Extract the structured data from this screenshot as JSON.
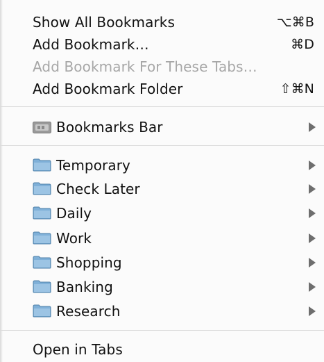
{
  "menu": {
    "top_items": [
      {
        "label": "Show All Bookmarks",
        "shortcut": "⌥⌘B",
        "enabled": true
      },
      {
        "label": "Add Bookmark…",
        "shortcut": "⌘D",
        "enabled": true
      },
      {
        "label": "Add Bookmark For These Tabs…",
        "shortcut": "",
        "enabled": false
      },
      {
        "label": "Add Bookmark Folder",
        "shortcut": "⇧⌘N",
        "enabled": true
      }
    ],
    "bookmarks_bar": {
      "label": "Bookmarks Bar",
      "icon": "bookmarks-bar-icon",
      "has_submenu": true
    },
    "folders": [
      {
        "label": "Temporary",
        "icon": "folder-icon",
        "has_submenu": true
      },
      {
        "label": "Check Later",
        "icon": "folder-icon",
        "has_submenu": true
      },
      {
        "label": "Daily",
        "icon": "folder-icon",
        "has_submenu": true
      },
      {
        "label": "Work",
        "icon": "folder-icon",
        "has_submenu": true
      },
      {
        "label": "Shopping",
        "icon": "folder-icon",
        "has_submenu": true
      },
      {
        "label": "Banking",
        "icon": "folder-icon",
        "has_submenu": true
      },
      {
        "label": "Research",
        "icon": "folder-icon",
        "has_submenu": true
      }
    ],
    "bottom_item": {
      "label": "Open in Tabs"
    },
    "colors": {
      "folder_fill": "#7fb0d8",
      "folder_stroke": "#4e7fa8",
      "disabled_text": "#a7a7a7",
      "arrow": "#6e6e6e"
    }
  }
}
